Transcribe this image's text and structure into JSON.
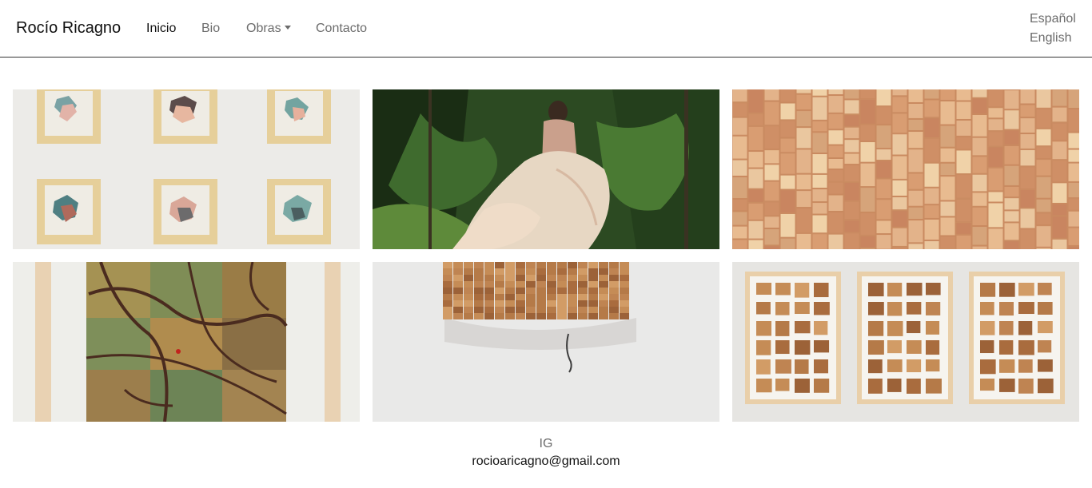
{
  "brand": "Rocío Ricagno",
  "nav": {
    "inicio": "Inicio",
    "bio": "Bio",
    "obras": "Obras",
    "contacto": "Contacto"
  },
  "languages": [
    "Español",
    "English"
  ],
  "footer": {
    "ig": "IG",
    "email": "rocioaricagno@gmail.com"
  },
  "colors": {
    "text_dark": "#111111",
    "text_muted": "#6c6c6c",
    "divider": "#333333"
  }
}
